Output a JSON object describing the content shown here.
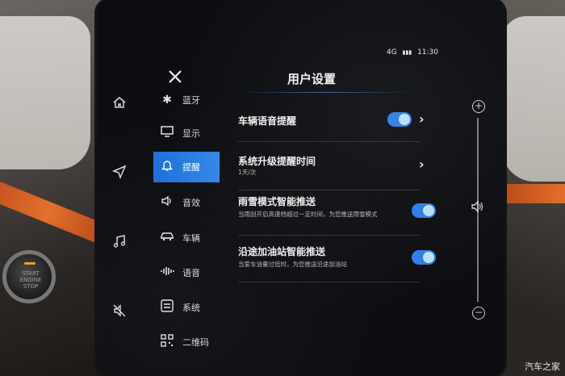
{
  "statusbar": {
    "network": "4G",
    "signal": "▮▮▮",
    "time": "11:30"
  },
  "header": {
    "title": "用户设置"
  },
  "menu": [
    {
      "label": "蓝牙",
      "icon": "bluetooth-icon"
    },
    {
      "label": "显示",
      "icon": "display-icon"
    },
    {
      "label": "提醒",
      "icon": "bell-icon",
      "active": true
    },
    {
      "label": "音效",
      "icon": "speaker-icon"
    },
    {
      "label": "车辆",
      "icon": "car-icon"
    },
    {
      "label": "语音",
      "icon": "voice-icon"
    },
    {
      "label": "系统",
      "icon": "system-icon"
    },
    {
      "label": "二维码",
      "icon": "qrcode-icon"
    }
  ],
  "settings": [
    {
      "title": "车辆语音提醒",
      "subtitle": "",
      "control": "toggle+chevron",
      "on": true
    },
    {
      "title": "系统升级提醒时间",
      "subtitle": "1天/次",
      "control": "chevron"
    },
    {
      "title": "雨雪模式智能推送",
      "subtitle": "当雨刮开启高速档超过一定时间，为您推送雨雪模式",
      "control": "toggle",
      "on": true
    },
    {
      "title": "沿途加油站智能推送",
      "subtitle": "当爱车油量过低时，为您推送沿途加油站",
      "control": "toggle",
      "on": true
    }
  ],
  "start_button": {
    "line1": "START",
    "line2": "ENGINE",
    "line3": "STOP"
  },
  "watermark": "汽车之家",
  "colors": {
    "accent": "#2c7de6",
    "active_menu": "#1a6fd8",
    "orange_trim": "#e3702c"
  }
}
